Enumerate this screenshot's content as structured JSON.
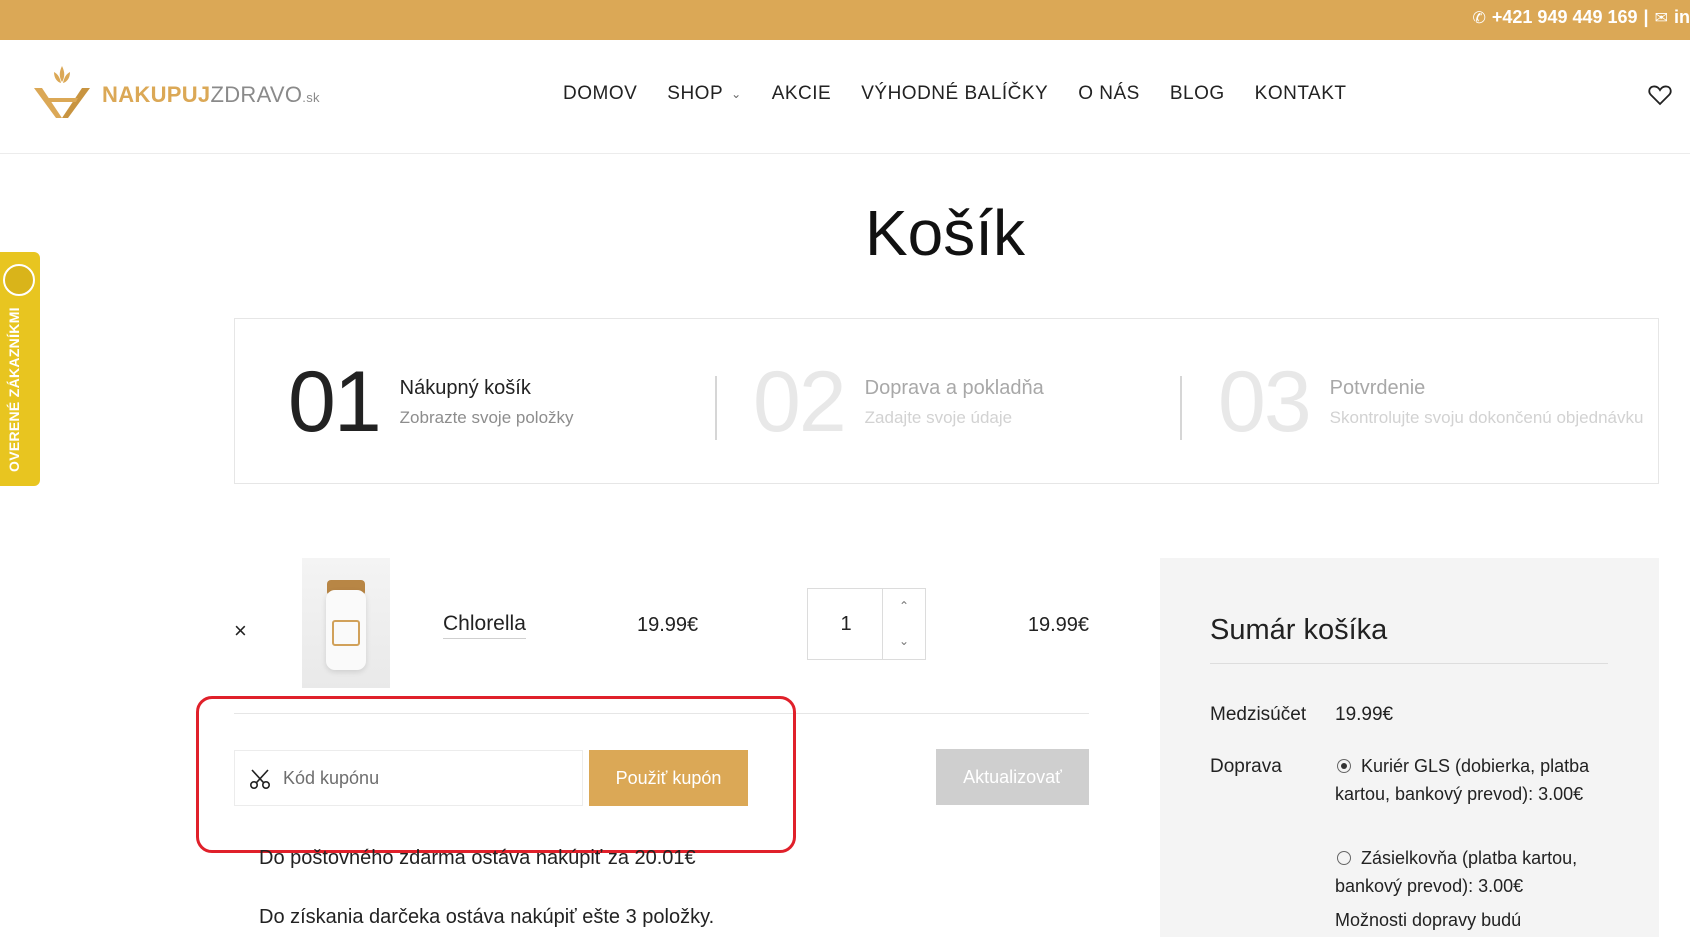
{
  "topbar": {
    "phone": "+421 949 449 169",
    "separator": "|",
    "email_fragment": "in"
  },
  "header": {
    "brand_bold": "NAKUPUJ",
    "brand_light": "ZDRAVO",
    "brand_tld": ".sk",
    "nav": [
      "DOMOV",
      "SHOP",
      "AKCIE",
      "VÝHODNÉ BALÍČKY",
      "O NÁS",
      "BLOG",
      "KONTAKT"
    ]
  },
  "side_badge": {
    "text": "OVERENÉ ZÁKAZNÍKMI"
  },
  "page": {
    "title": "Košík"
  },
  "steps": [
    {
      "num": "01",
      "title": "Nákupný košík",
      "subtitle": "Zobrazte svoje položky"
    },
    {
      "num": "02",
      "title": "Doprava a pokladňa",
      "subtitle": "Zadajte svoje údaje"
    },
    {
      "num": "03",
      "title": "Potvrdenie",
      "subtitle": "Skontrolujte svoju dokončenú objednávku"
    }
  ],
  "cart": {
    "remove": "×",
    "item": {
      "name": "Chlorella",
      "price": "19.99€",
      "quantity": "1",
      "subtotal": "19.99€"
    },
    "coupon_placeholder": "Kód kupónu",
    "apply_label": "Použiť kupón",
    "update_label": "Aktualizovať",
    "notes": [
      "Do poštovného zdarma ostáva nakúpiť za 20.01€",
      "Do získania darčeka ostáva nakúpiť ešte 3 položky."
    ]
  },
  "summary": {
    "title": "Sumár košíka",
    "subtotal_label": "Medzisúčet",
    "subtotal_value": "19.99€",
    "shipping_label": "Doprava",
    "shipping_options": [
      {
        "label": "Kuriér GLS (dobierka, platba kartou, bankový prevod): 3.00€",
        "selected": true
      },
      {
        "label": "Zásielkovňa (platba kartou, bankový prevod): 3.00€",
        "selected": false
      }
    ],
    "shipping_note": "Možnosti dopravy budú"
  },
  "colors": {
    "accent": "#dba856",
    "highlight": "#e0202a",
    "badge": "#e8c520"
  }
}
